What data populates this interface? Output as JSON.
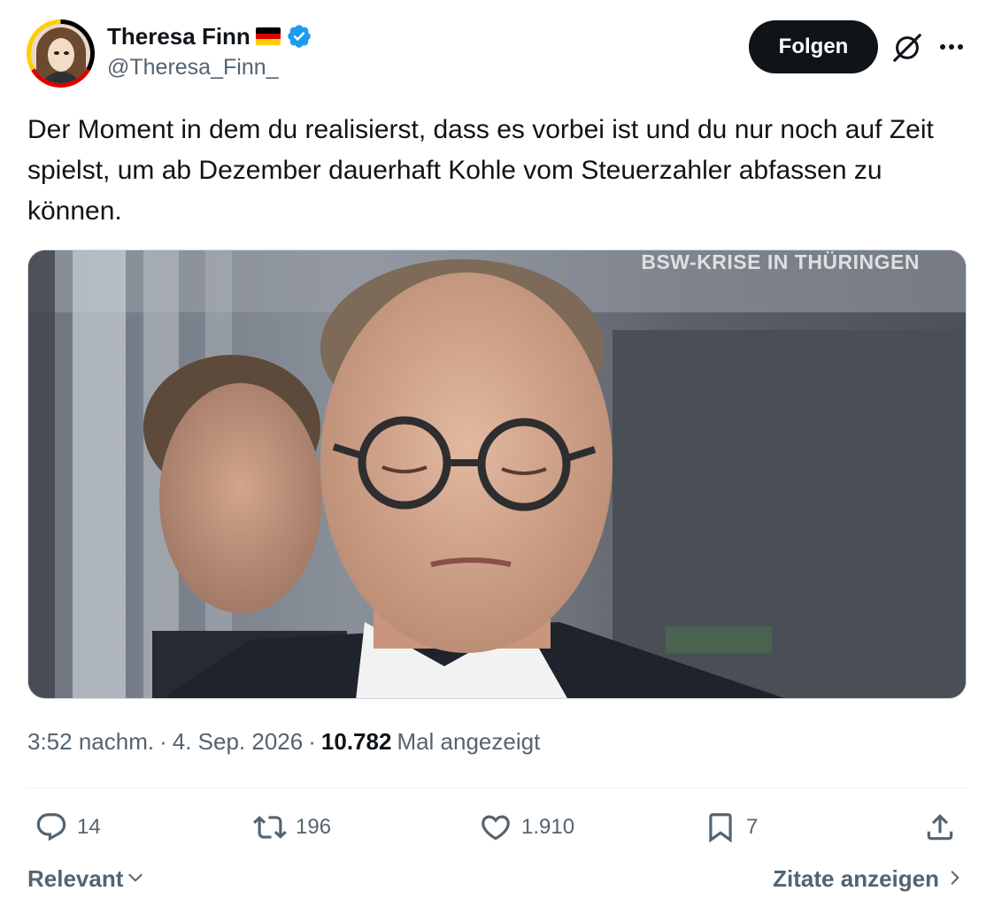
{
  "author": {
    "display_name": "Theresa Finn",
    "handle": "@Theresa_Finn_",
    "flag_colors": [
      "#000000",
      "#dd0000",
      "#ffce00"
    ],
    "verified_color": "#1d9bf0"
  },
  "header": {
    "follow_label": "Folgen",
    "grok_icon": "grok-icon",
    "more_icon": "more-icon"
  },
  "tweet": {
    "text": "Der Moment in dem du realisierst, dass es vorbei ist und du nur noch auf Zeit spielst, um ab Dezember dauerhaft Kohle vom Steuerzahler abfassen zu können.",
    "media_caption": "BSW-KRISE IN THÜRINGEN"
  },
  "meta": {
    "time": "3:52 nachm.",
    "separator": "·",
    "date": "4. Sep. 2026",
    "views_count": "10.782",
    "views_label": "Mal angezeigt"
  },
  "actions": {
    "replies": "14",
    "reposts": "196",
    "likes": "1.910",
    "bookmarks": "7"
  },
  "footer": {
    "sort_label": "Relevant",
    "quotes_label": "Zitate anzeigen"
  },
  "colors": {
    "text_primary": "#0f1419",
    "text_secondary": "#536471",
    "divider": "#eff3f4",
    "button_bg": "#0f1419"
  }
}
